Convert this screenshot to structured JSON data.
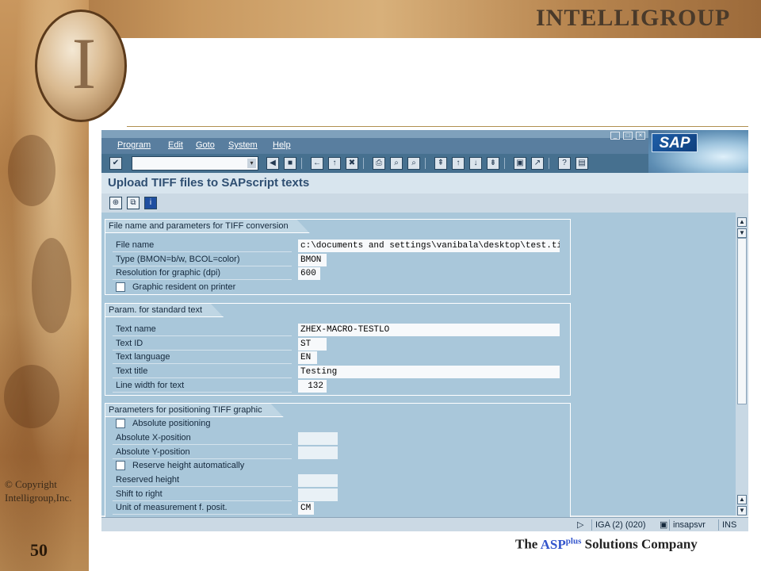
{
  "slide": {
    "brand": "INTELLIGROUP",
    "logo_letter": "I",
    "copyright_line1": "© Copyright",
    "copyright_line2": "Intelligroup,Inc.",
    "slide_number": "50",
    "tagline_pre": "The ",
    "tagline_asp": "ASP",
    "tagline_plus": "plus",
    "tagline_post": " Solutions Company"
  },
  "sap": {
    "logo": "SAP",
    "menu": [
      "Program",
      "Edit",
      "Goto",
      "System",
      "Help"
    ],
    "command_field": {
      "value": ""
    },
    "screen_title": "Upload TIFF files to SAPscript texts",
    "groups": {
      "file": {
        "title": "File name and parameters for TIFF conversion",
        "file_name_label": "File name",
        "file_name_value": "c:\\documents and settings\\vanibala\\desktop\\test.tif",
        "type_label": "Type (BMON=b/w, BCOL=color)",
        "type_value": "BMON",
        "resolution_label": "Resolution for graphic (dpi)",
        "resolution_value": "600",
        "resident_label": "Graphic resident on printer"
      },
      "text": {
        "title": "Param. for standard text",
        "name_label": "Text name",
        "name_value": "ZHEX-MACRO-TESTLO",
        "id_label": "Text ID",
        "id_value": "ST",
        "lang_label": "Text language",
        "lang_value": "EN",
        "title_label": "Text title",
        "title_value": "Testing",
        "width_label": "Line width for text",
        "width_value": "132"
      },
      "position": {
        "title": "Parameters for positioning TIFF graphic",
        "absolute_label": "Absolute positioning",
        "xpos_label": "Absolute X-position",
        "xpos_value": "",
        "ypos_label": "Absolute Y-position",
        "ypos_value": "",
        "reserve_auto_label": "Reserve height automatically",
        "reserved_label": "Reserved height",
        "reserved_value": "",
        "shift_label": "Shift to right",
        "shift_value": "",
        "unit_label": "Unit of measurement f. posit.",
        "unit_value": "CM"
      }
    },
    "status": {
      "system": "IGA (2) (020)",
      "server": "insapsvr",
      "mode": "INS"
    }
  }
}
